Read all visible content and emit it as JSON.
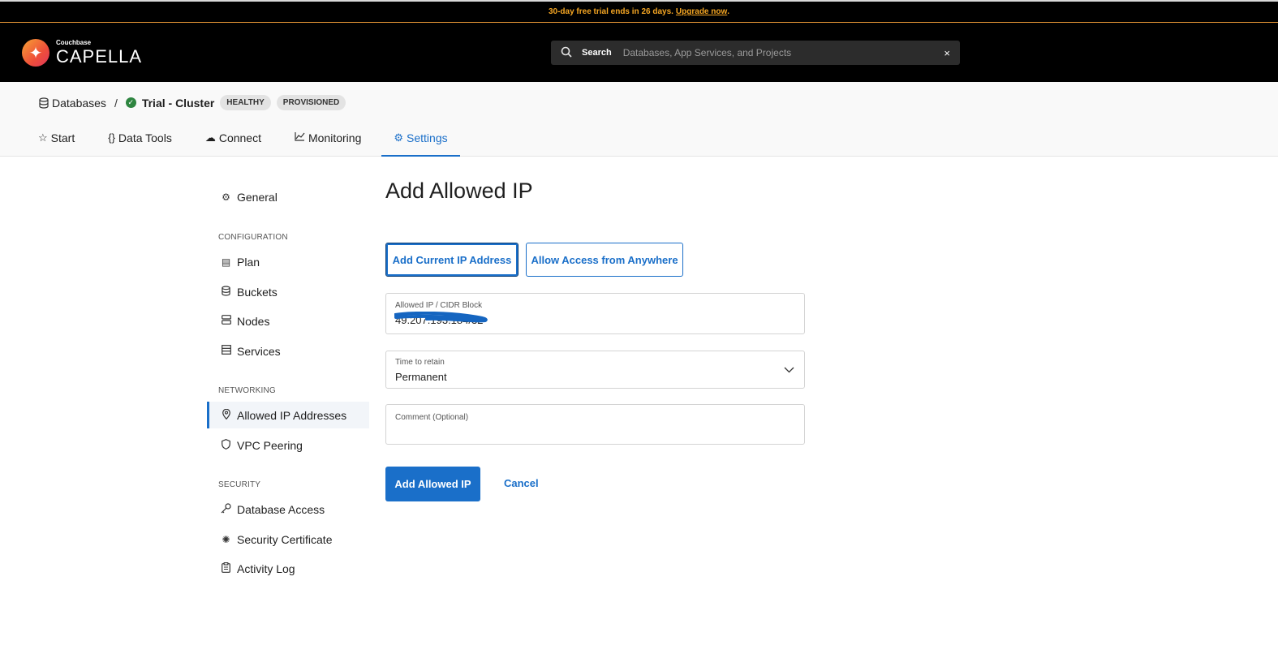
{
  "banner": {
    "text": "30-day free trial ends in 26 days.",
    "link": "Upgrade now",
    "suffix": "."
  },
  "header": {
    "logo_small": "Couchbase",
    "logo_big": "CAPELLA",
    "search_label": "Search",
    "search_placeholder": "Databases, App Services, and Projects",
    "clear_icon": "×"
  },
  "breadcrumb": {
    "databases": "Databases",
    "separator": "/",
    "cluster": "Trial - Cluster",
    "badges": [
      "HEALTHY",
      "PROVISIONED"
    ]
  },
  "tabs": [
    {
      "label": "Start",
      "icon": "star-icon"
    },
    {
      "label": "Data Tools",
      "icon": "braces-icon"
    },
    {
      "label": "Connect",
      "icon": "cloud-link-icon"
    },
    {
      "label": "Monitoring",
      "icon": "chart-icon"
    },
    {
      "label": "Settings",
      "icon": "gear-icon",
      "active": true
    }
  ],
  "sidenav": {
    "general": "General",
    "groups": {
      "configuration": "CONFIGURATION",
      "networking": "NETWORKING",
      "security": "SECURITY"
    },
    "items": {
      "plan": "Plan",
      "buckets": "Buckets",
      "nodes": "Nodes",
      "services": "Services",
      "allowed_ip": "Allowed IP Addresses",
      "vpc": "VPC Peering",
      "db_access": "Database Access",
      "sec_cert": "Security Certificate",
      "activity": "Activity Log"
    }
  },
  "form": {
    "title": "Add Allowed IP",
    "add_current_ip": "Add Current IP Address",
    "allow_anywhere": "Allow Access from Anywhere",
    "ip_label": "Allowed IP / CIDR Block",
    "ip_value": "49.207.193.184/32",
    "retain_label": "Time to retain",
    "retain_value": "Permanent",
    "comment_label": "Comment (Optional)",
    "submit": "Add Allowed IP",
    "cancel": "Cancel"
  },
  "colors": {
    "accent": "#1a6fc9",
    "banner_text": "#f5a623",
    "healthy": "#2e8540"
  }
}
